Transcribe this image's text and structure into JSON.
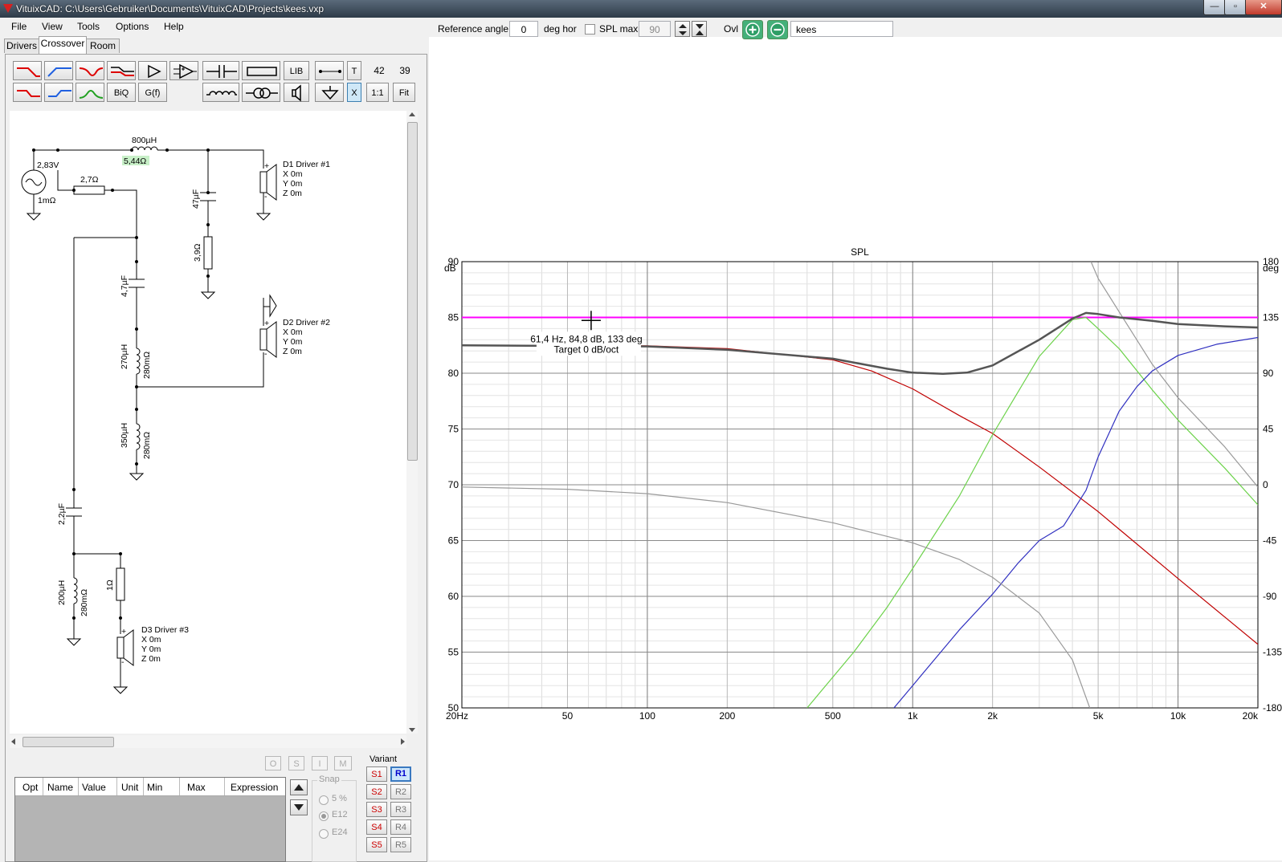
{
  "window": {
    "title": "VituixCAD: C:\\Users\\Gebruiker\\Documents\\VituixCAD\\Projects\\kees.vxp",
    "btn_minimize": "—",
    "btn_restore": "▫",
    "btn_close": "✕"
  },
  "menu": [
    "File",
    "View",
    "Tools",
    "Options",
    "Help"
  ],
  "tabs": [
    "Drivers",
    "Crossover",
    "Room"
  ],
  "toolbar": {
    "lib": "LIB",
    "t": "T",
    "biq": "BiQ",
    "gf": "G(f)",
    "one_to_one": "1:1",
    "fit": "Fit",
    "x": "X",
    "num1": "42",
    "num2": "39"
  },
  "top_controls": {
    "reference_angle_label": "Reference angle",
    "reference_angle_value": "0",
    "deg_hor": "deg hor",
    "spl_max_label": "SPL max",
    "spl_max_value": "90",
    "ovl_label": "Ovl",
    "name_value": "kees"
  },
  "schematic": {
    "source_v": "2,83V",
    "source_r": "1mΩ",
    "l_series": "800µH",
    "l_series_r": "5,44Ω",
    "r_divider": "2,7Ω",
    "c_zobel": "47µF",
    "r_zobel": "3,9Ω",
    "c_mid": "4,7µF",
    "l_mid1": "270µH",
    "l_mid1_r": "280mΩ",
    "l_mid2": "350µH",
    "l_mid2_r": "280mΩ",
    "c_tw": "2,2µF",
    "l_tw": "200µH",
    "l_tw_r": "280mΩ",
    "r_tw": "1Ω",
    "drivers": [
      {
        "name": "D1 Driver #1",
        "x": "X 0m",
        "y": "Y 0m",
        "z": "Z 0m"
      },
      {
        "name": "D2 Driver #2",
        "x": "X 0m",
        "y": "Y 0m",
        "z": "Z 0m"
      },
      {
        "name": "D3 Driver #3",
        "x": "X 0m",
        "y": "Y 0m",
        "z": "Z 0m"
      }
    ],
    "plus": "+",
    "minus": "-"
  },
  "bottom": {
    "omni_buttons": [
      "O",
      "S",
      "I",
      "M"
    ],
    "table_headers": [
      "Opt",
      "Name",
      "Value",
      "Unit",
      "Min",
      "Max",
      "Expression"
    ],
    "snap_label": "Snap",
    "snap_options": [
      "5 %",
      "E12",
      "E24"
    ],
    "snap_selected": "E12",
    "variant_label": "Variant",
    "s_buttons": [
      "S1",
      "S2",
      "S3",
      "S4",
      "S5"
    ],
    "r_buttons": [
      "R1",
      "R2",
      "R3",
      "R4",
      "R5"
    ],
    "active_variant": "R1"
  },
  "chart_data": {
    "type": "line",
    "title": "SPL",
    "xscale": "log",
    "xlim": [
      20,
      20000
    ],
    "x_ticks": [
      20,
      50,
      100,
      200,
      500,
      1000,
      2000,
      5000,
      10000,
      20000
    ],
    "x_tick_labels": [
      "20Hz",
      "50",
      "100",
      "200",
      "500",
      "1k",
      "2k",
      "5k",
      "10k",
      "20k"
    ],
    "ylim": [
      50,
      90
    ],
    "y_ticks": [
      50,
      55,
      60,
      65,
      70,
      75,
      80,
      85,
      90
    ],
    "y_tick_labels": [
      "50",
      "55",
      "60",
      "65",
      "70",
      "75",
      "80",
      "85",
      "90"
    ],
    "ylabel": "dB",
    "y2lim": [
      -180,
      180
    ],
    "y2_ticks": [
      -180,
      -135,
      -90,
      -45,
      0,
      45,
      90,
      135,
      180
    ],
    "y2_tick_labels": [
      "-180",
      "-135",
      "-90",
      "-45",
      "0",
      "45",
      "90",
      "135",
      "180"
    ],
    "y2label": "deg",
    "grid": true,
    "cursor": {
      "x": 61.4,
      "y": 84.8
    },
    "annotation_line1": "61,4 Hz, 84,8 dB, 133 deg",
    "annotation_line2": "Target 0 dB/oct",
    "series": [
      {
        "color": "#ff00ff",
        "width": 2,
        "points": [
          [
            20,
            85
          ],
          [
            20000,
            85
          ]
        ]
      },
      {
        "color": "#c00000",
        "width": 1.2,
        "points": [
          [
            20,
            82.5
          ],
          [
            100,
            82.45
          ],
          [
            200,
            82.2
          ],
          [
            500,
            81.2
          ],
          [
            700,
            80.2
          ],
          [
            1000,
            78.6
          ],
          [
            1500,
            76.2
          ],
          [
            2000,
            74.6
          ],
          [
            3000,
            71.6
          ],
          [
            5000,
            67.6
          ],
          [
            10000,
            61.6
          ],
          [
            20000,
            55.7
          ]
        ]
      },
      {
        "color": "#6cd24a",
        "width": 1.2,
        "points": [
          [
            400,
            50
          ],
          [
            600,
            55
          ],
          [
            800,
            59
          ],
          [
            1000,
            62.5
          ],
          [
            1500,
            69
          ],
          [
            2000,
            74.5
          ],
          [
            3000,
            81.5
          ],
          [
            4000,
            84.8
          ],
          [
            4500,
            85
          ],
          [
            5000,
            84
          ],
          [
            6000,
            82.2
          ],
          [
            8000,
            78.5
          ],
          [
            10000,
            75.8
          ],
          [
            15000,
            71.5
          ],
          [
            20000,
            68.2
          ]
        ]
      },
      {
        "color": "#3030c0",
        "width": 1.2,
        "points": [
          [
            850,
            50
          ],
          [
            1000,
            52
          ],
          [
            1500,
            57
          ],
          [
            2000,
            60.2
          ],
          [
            2500,
            63
          ],
          [
            3000,
            65
          ],
          [
            3700,
            66.3
          ],
          [
            4500,
            69.5
          ],
          [
            5000,
            72.5
          ],
          [
            6000,
            76.6
          ],
          [
            7000,
            78.8
          ],
          [
            8000,
            80.2
          ],
          [
            10000,
            81.6
          ],
          [
            14000,
            82.6
          ],
          [
            20000,
            83.2
          ]
        ]
      },
      {
        "color": "#999999",
        "width": 1.2,
        "points": [
          [
            20,
            69.8
          ],
          [
            50,
            69.6
          ],
          [
            100,
            69.2
          ],
          [
            200,
            68.4
          ],
          [
            500,
            66.6
          ],
          [
            1000,
            64.8
          ],
          [
            1500,
            63.3
          ],
          [
            2000,
            61.7
          ],
          [
            3000,
            58.5
          ],
          [
            4000,
            54.3
          ],
          [
            4650,
            50
          ]
        ]
      },
      {
        "color": "#999999",
        "width": 1.2,
        "points": [
          [
            4700,
            90
          ],
          [
            5000,
            88.5
          ],
          [
            6000,
            85.5
          ],
          [
            8000,
            80.8
          ],
          [
            10000,
            77.8
          ],
          [
            15000,
            73.4
          ],
          [
            20000,
            69.8
          ]
        ]
      },
      {
        "color": "#555555",
        "width": 2.5,
        "points": [
          [
            20,
            82.5
          ],
          [
            100,
            82.4
          ],
          [
            200,
            82.1
          ],
          [
            500,
            81.3
          ],
          [
            800,
            80.4
          ],
          [
            1000,
            80.05
          ],
          [
            1300,
            79.95
          ],
          [
            1600,
            80.05
          ],
          [
            2000,
            80.7
          ],
          [
            3000,
            83
          ],
          [
            4000,
            84.9
          ],
          [
            4500,
            85.4
          ],
          [
            5000,
            85.3
          ],
          [
            6000,
            85
          ],
          [
            8000,
            84.7
          ],
          [
            10000,
            84.4
          ],
          [
            15000,
            84.2
          ],
          [
            20000,
            84.1
          ]
        ]
      }
    ]
  }
}
